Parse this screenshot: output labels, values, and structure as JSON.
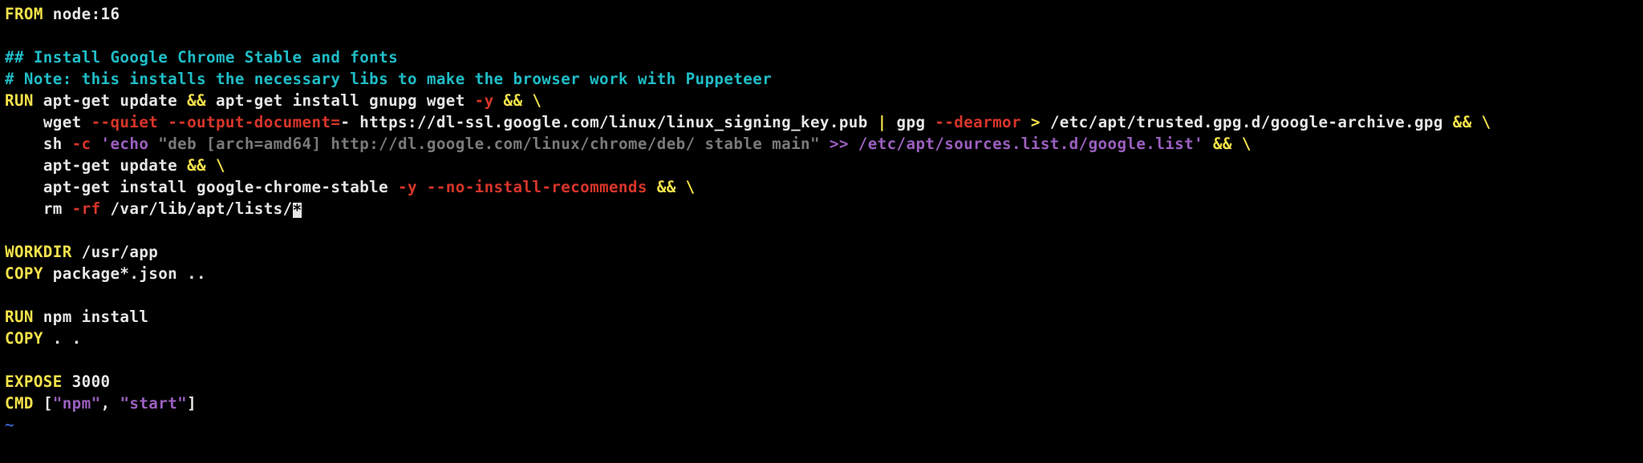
{
  "docker": {
    "from_kw": "FROM",
    "from_val": " node:16",
    "comment1": "## Install Google Chrome Stable and fonts",
    "comment2": "# Note: this installs the necessary libs to make the browser work with Puppeteer",
    "run1_kw": "RUN",
    "run1_a": " apt-get update ",
    "amp": "&&",
    "run1_b": " apt-get install gnupg wget ",
    "flag_y": "-y",
    "space": " ",
    "bs": " \\",
    "indent": "    ",
    "wget": "wget ",
    "flag_quiet": "--quiet",
    "flag_outdoc": "--output-document=",
    "wget_rest": "- https://dl-ssl.google.com/linux/linux_signing_key.pub ",
    "pipe": "|",
    "gpg": " gpg ",
    "flag_dearmor": "--dearmor",
    "gt": " > ",
    "gpg_path": "/etc/apt/trusted.gpg.d/google-archive.gpg ",
    "sh": "sh ",
    "flag_c": "-c",
    "sq_open": " '",
    "sh_echo": "echo ",
    "sh_dq": "\"deb [arch=amd64] http://dl.google.com/linux/chrome/deb/ stable main\"",
    "sh_redir": " >> /etc/apt/sources.list.d/google.list",
    "sq_close": "'",
    "apt_update": "apt-get update ",
    "apt_install": "apt-get install google-chrome-stable ",
    "flag_norecs": "--no-install-recommends",
    "rm": "rm ",
    "flag_rf": "-rf",
    "rm_path": " /var/lib/apt/lists/",
    "cursor_char": "*",
    "workdir_kw": "WORKDIR",
    "workdir_val": " /usr/app",
    "copy_kw": "COPY",
    "copy1_val": " package*.json ..",
    "run2_kw": "RUN",
    "run2_val": " npm install",
    "copy2_val": " . .",
    "expose_kw": "EXPOSE",
    "expose_val": " 3000",
    "cmd_kw": "CMD",
    "cmd_sp": " ",
    "br_open": "[",
    "cmd_npm": "\"npm\"",
    "comma": ", ",
    "cmd_start": "\"start\"",
    "br_close": "]",
    "tilde": "~"
  }
}
